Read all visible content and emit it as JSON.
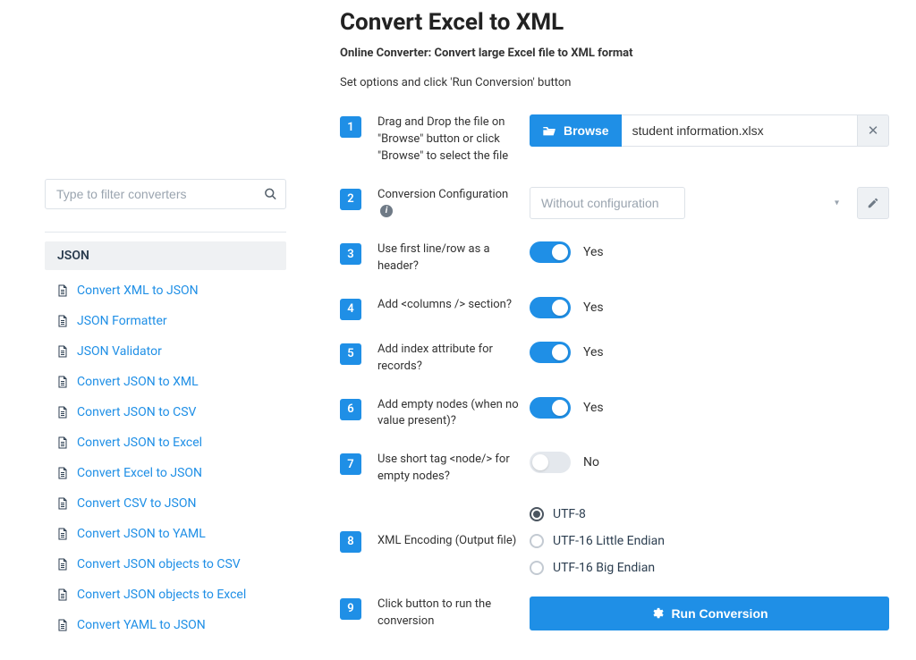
{
  "sidebar": {
    "filter_placeholder": "Type to filter converters",
    "category": "JSON",
    "items": [
      {
        "label": "Convert XML to JSON"
      },
      {
        "label": "JSON Formatter"
      },
      {
        "label": "JSON Validator"
      },
      {
        "label": "Convert JSON to XML"
      },
      {
        "label": "Convert JSON to CSV"
      },
      {
        "label": "Convert JSON to Excel"
      },
      {
        "label": "Convert Excel to JSON"
      },
      {
        "label": "Convert CSV to JSON"
      },
      {
        "label": "Convert JSON to YAML"
      },
      {
        "label": "Convert JSON objects to CSV"
      },
      {
        "label": "Convert JSON objects to Excel"
      },
      {
        "label": "Convert YAML to JSON"
      }
    ]
  },
  "main": {
    "title": "Convert Excel to XML",
    "subtitle": "Online Converter: Convert large Excel file to XML format",
    "instruction": "Set options and click 'Run Conversion' button"
  },
  "steps": {
    "s1": {
      "num": "1",
      "label": "Drag and Drop the file on \"Browse\" button or click \"Browse\" to select the file"
    },
    "s2": {
      "num": "2",
      "label": "Conversion Configuration"
    },
    "s3": {
      "num": "3",
      "label": "Use first line/row as a header?"
    },
    "s4": {
      "num": "4",
      "label": "Add <columns /> section?"
    },
    "s5": {
      "num": "5",
      "label": "Add index attribute for records?"
    },
    "s6": {
      "num": "6",
      "label": "Add empty nodes (when no value present)?"
    },
    "s7": {
      "num": "7",
      "label": "Use short tag <node/> for empty nodes?"
    },
    "s8": {
      "num": "8",
      "label": "XML Encoding (Output file)"
    },
    "s9": {
      "num": "9",
      "label": "Click button to run the conversion"
    }
  },
  "file": {
    "browse": "Browse",
    "name": "student information.xlsx"
  },
  "config": {
    "selected": "Without configuration"
  },
  "toggles": {
    "yes": "Yes",
    "no": "No"
  },
  "encoding": {
    "opt1": "UTF-8",
    "opt2": "UTF-16 Little Endian",
    "opt3": "UTF-16 Big Endian"
  },
  "run": {
    "label": "Run Conversion"
  }
}
